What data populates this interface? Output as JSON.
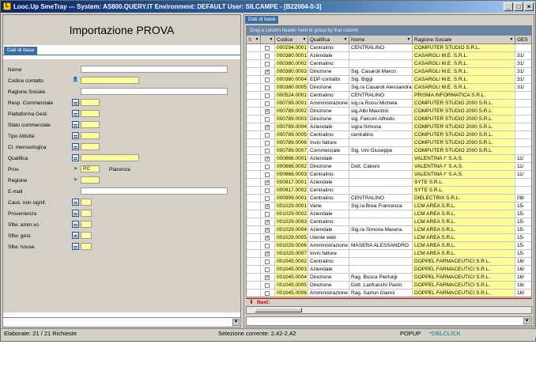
{
  "window": {
    "title": "Looc.Up SmeTray --- System: AS800.QUERY.IT Environment: DEFAULT User: SILCAMPE - [B22004-0-3]",
    "icon_label": "L",
    "buttons": {
      "minimize": "_",
      "maximize": "□",
      "close": "×"
    }
  },
  "left": {
    "heading": "Importazione PROVA",
    "tab": "Dati di base",
    "fields": [
      {
        "label": "Nome",
        "value": "",
        "icon": "",
        "style": "white-wide"
      },
      {
        "label": "Codice contatto",
        "value": "",
        "icon": "person-icon",
        "style": "yellow-mid"
      },
      {
        "label": "Ragione Sociale",
        "value": "",
        "icon": "",
        "style": "white-wide"
      },
      {
        "label": "Resp. Commerciale",
        "value": "",
        "icon": "grid-icon",
        "style": "yellow-short"
      },
      {
        "label": "Piattaforma Gest.",
        "value": "",
        "icon": "grid-icon",
        "style": "yellow-short"
      },
      {
        "label": "Stato commerciale",
        "value": "",
        "icon": "grid-icon",
        "style": "yellow-short"
      },
      {
        "label": "Tipo Attività",
        "value": "",
        "icon": "grid-icon",
        "style": "yellow-short"
      },
      {
        "label": "Cl. merceologica",
        "value": "",
        "icon": "grid-icon",
        "style": "yellow-short"
      },
      {
        "label": "Qualifica",
        "value": "",
        "icon": "grid-icon",
        "style": "yellow-mid"
      },
      {
        "label": "Prov.",
        "value": "PC",
        "icon": "map-icon",
        "style": "yellow-short",
        "extra": "Piacenza"
      },
      {
        "label": "Regione",
        "value": "",
        "icon": "map-icon",
        "style": "yellow-short"
      },
      {
        "label": "E-mail",
        "value": "",
        "icon": "",
        "style": "white-wide"
      },
      {
        "label": "Caus. non signif.",
        "value": "",
        "icon": "grid-icon",
        "style": "yellow-tiny"
      },
      {
        "label": "Provenienza",
        "value": "",
        "icon": "grid-icon",
        "style": "yellow-tiny"
      },
      {
        "label": "Sftw. amm.vo",
        "value": "",
        "icon": "grid-icon",
        "style": "yellow-tiny"
      },
      {
        "label": "Sftw. gest.",
        "value": "",
        "icon": "grid-icon",
        "style": "yellow-tiny"
      },
      {
        "label": "Sftw. house",
        "value": "",
        "icon": "grid-icon",
        "style": "yellow-tiny"
      }
    ]
  },
  "right": {
    "tab": "Dati di base",
    "group_hint": "Drag a column header here to group by that column",
    "columns": [
      "S",
      "",
      "Codice",
      "Qualifica",
      "Nome",
      "Ragione Sociale",
      "GES"
    ],
    "rows": [
      {
        "checked": false,
        "codice": "000294.0001",
        "qualifica": "Centralino",
        "nome": "CENTRALINO",
        "ragione": "COMPUTER STUDIO S.R.L.",
        "ges": ""
      },
      {
        "checked": false,
        "codice": "000380.0001",
        "qualifica": "Aziendale",
        "nome": "",
        "ragione": "CASAROLI M.E. S.R.L.",
        "ges": "31/"
      },
      {
        "checked": false,
        "codice": "000380.0002",
        "qualifica": "Centralino",
        "nome": "",
        "ragione": "CASAROLI M.E. S.R.L.",
        "ges": "31/"
      },
      {
        "checked": true,
        "codice": "000380.0003",
        "qualifica": "Direzione",
        "nome": "Sig. Casaroli Marco",
        "ragione": "CASAROLI M.E. S.R.L.",
        "ges": "31/"
      },
      {
        "checked": false,
        "codice": "000380.0004",
        "qualifica": "EDP contatto",
        "nome": "Sig. Biggi",
        "ragione": "CASAROLI M.E. S.R.L.",
        "ges": "31/"
      },
      {
        "checked": false,
        "codice": "000380.0005",
        "qualifica": "Direzione",
        "nome": "Sig.ra Casaroli Alessandra",
        "ragione": "CASAROLI M.E. S.R.L.",
        "ges": "31/"
      },
      {
        "checked": false,
        "codice": "000524.0001",
        "qualifica": "Centralino",
        "nome": "CENTRALINO",
        "ragione": "PRISMA INFORMATICA S.R.L.",
        "ges": ""
      },
      {
        "checked": false,
        "codice": "000789.0001",
        "qualifica": "Amministrazione",
        "nome": "sig.ra Rossi Michela",
        "ragione": "COMPUTER STUDIO 2000 S.R.L.",
        "ges": ""
      },
      {
        "checked": true,
        "codice": "000789.0002",
        "qualifica": "Direzione",
        "nome": "sig.Albi Maurizio",
        "ragione": "COMPUTER STUDIO 2000 S.R.L.",
        "ges": ""
      },
      {
        "checked": false,
        "codice": "000789.0003",
        "qualifica": "Direzione",
        "nome": "sig. Falconi Alfredo",
        "ragione": "COMPUTER STUDIO 2000 S.R.L.",
        "ges": ""
      },
      {
        "checked": true,
        "codice": "000789.0004",
        "qualifica": "Aziendale",
        "nome": "sigra Simona",
        "ragione": "COMPUTER STUDIO 2000 S.R.L.",
        "ges": ""
      },
      {
        "checked": false,
        "codice": "000789.0005",
        "qualifica": "Centralino",
        "nome": "centralino",
        "ragione": "COMPUTER STUDIO 2000 S.R.L.",
        "ges": ""
      },
      {
        "checked": false,
        "codice": "000789.0006",
        "qualifica": "Invio fatture",
        "nome": "",
        "ragione": "COMPUTER STUDIO 2000 S.R.L.",
        "ges": ""
      },
      {
        "checked": false,
        "codice": "000789.0007",
        "qualifica": "Commerciale",
        "nome": "Sig. Uni Giuseppe",
        "ragione": "COMPUTER STUDIO 2000 S.R.L.",
        "ges": ""
      },
      {
        "checked": true,
        "codice": "000866.0001",
        "qualifica": "Aziendale",
        "nome": "",
        "ragione": "VALENTINA I° S.A.S.",
        "ges": "11/"
      },
      {
        "checked": false,
        "codice": "000866.0002",
        "qualifica": "Direzione",
        "nome": "Dott. Caboni",
        "ragione": "VALENTINA I° S.A.S.",
        "ges": "11/"
      },
      {
        "checked": false,
        "codice": "000866.0003",
        "qualifica": "Centralino",
        "nome": "",
        "ragione": "VALENTINA I° S.A.S.",
        "ges": "11/"
      },
      {
        "checked": true,
        "codice": "000917.0001",
        "qualifica": "Aziendale",
        "nome": "",
        "ragione": "SYTE S.R.L.",
        "ges": ""
      },
      {
        "checked": false,
        "codice": "000917.0002",
        "qualifica": "Centralino",
        "nome": "",
        "ragione": "SYTE S.R.L.",
        "ges": ""
      },
      {
        "checked": false,
        "codice": "000999.0001",
        "qualifica": "Centralino",
        "nome": "CENTRALINO",
        "ragione": "DIELECTRIX S.R.L.",
        "ges": "08/"
      },
      {
        "checked": true,
        "codice": "001029.0001",
        "qualifica": "Varie",
        "nome": "Sig.ra Brea Francesca",
        "ragione": "LCM AREA S.R.L.",
        "ges": "15-"
      },
      {
        "checked": false,
        "codice": "001029.0002",
        "qualifica": "Aziendale",
        "nome": "",
        "ragione": "LCM AREA S.R.L.",
        "ges": "15-"
      },
      {
        "checked": true,
        "codice": "001029.0003",
        "qualifica": "Centralino",
        "nome": "",
        "ragione": "LCM AREA S.R.L.",
        "ges": "15-"
      },
      {
        "checked": true,
        "codice": "001029.0004",
        "qualifica": "Aziendale",
        "nome": "Sig.ra Simona Masera",
        "ragione": "LCM AREA S.R.L.",
        "ges": "15-"
      },
      {
        "checked": true,
        "codice": "001029.0005",
        "qualifica": "Utente web",
        "nome": "",
        "ragione": "LCM AREA S.R.L.",
        "ges": "15-"
      },
      {
        "checked": false,
        "codice": "001029.0006",
        "qualifica": "Amministrazione",
        "nome": "MASERA ALESSANDRO",
        "ragione": "LCM AREA S.R.L.",
        "ges": "15-"
      },
      {
        "checked": true,
        "codice": "001029.0007",
        "qualifica": "Invio fatture",
        "nome": "",
        "ragione": "LCM AREA S.R.L.",
        "ges": "15-"
      },
      {
        "checked": false,
        "codice": "001045.0002",
        "qualifica": "Centralino",
        "nome": "",
        "ragione": "DOPPEL FARMACEUTICI S.R.L.",
        "ges": "16/"
      },
      {
        "checked": false,
        "codice": "001045.0003",
        "qualifica": "Aziendale",
        "nome": "",
        "ragione": "DOPPEL FARMACEUTICI S.R.L.",
        "ges": "16/"
      },
      {
        "checked": true,
        "codice": "001045.0004",
        "qualifica": "Direzione",
        "nome": "Rag. Busca Pierluigi",
        "ragione": "DOPPEL FARMACEUTICI S.R.L.",
        "ges": "16/"
      },
      {
        "checked": false,
        "codice": "001045.0005",
        "qualifica": "Direzione",
        "nome": "Dott. Lanfranchi Paolo",
        "ragione": "DOPPEL FARMACEUTICI S.R.L.",
        "ges": "16/"
      },
      {
        "checked": false,
        "codice": "001045.0006",
        "qualifica": "Amministrazione",
        "nome": "Rag. Sartori Gianni",
        "ragione": "DOPPEL FARMACEUTICI S.R.L.",
        "ges": "16/"
      }
    ],
    "next_label": "Next:"
  },
  "status": {
    "left": "Elaborate: 21 / 21 Richieste",
    "middle": "Selezione corrente: 2,42-2,42",
    "popup": "POPUP",
    "dblclick": "*DBLCLICK"
  },
  "colors": {
    "title_start": "#0a246a",
    "title_end": "#a6caf0",
    "yellow_field": "#ffff99",
    "next_red": "#c00000",
    "dbl_teal": "#008080"
  }
}
